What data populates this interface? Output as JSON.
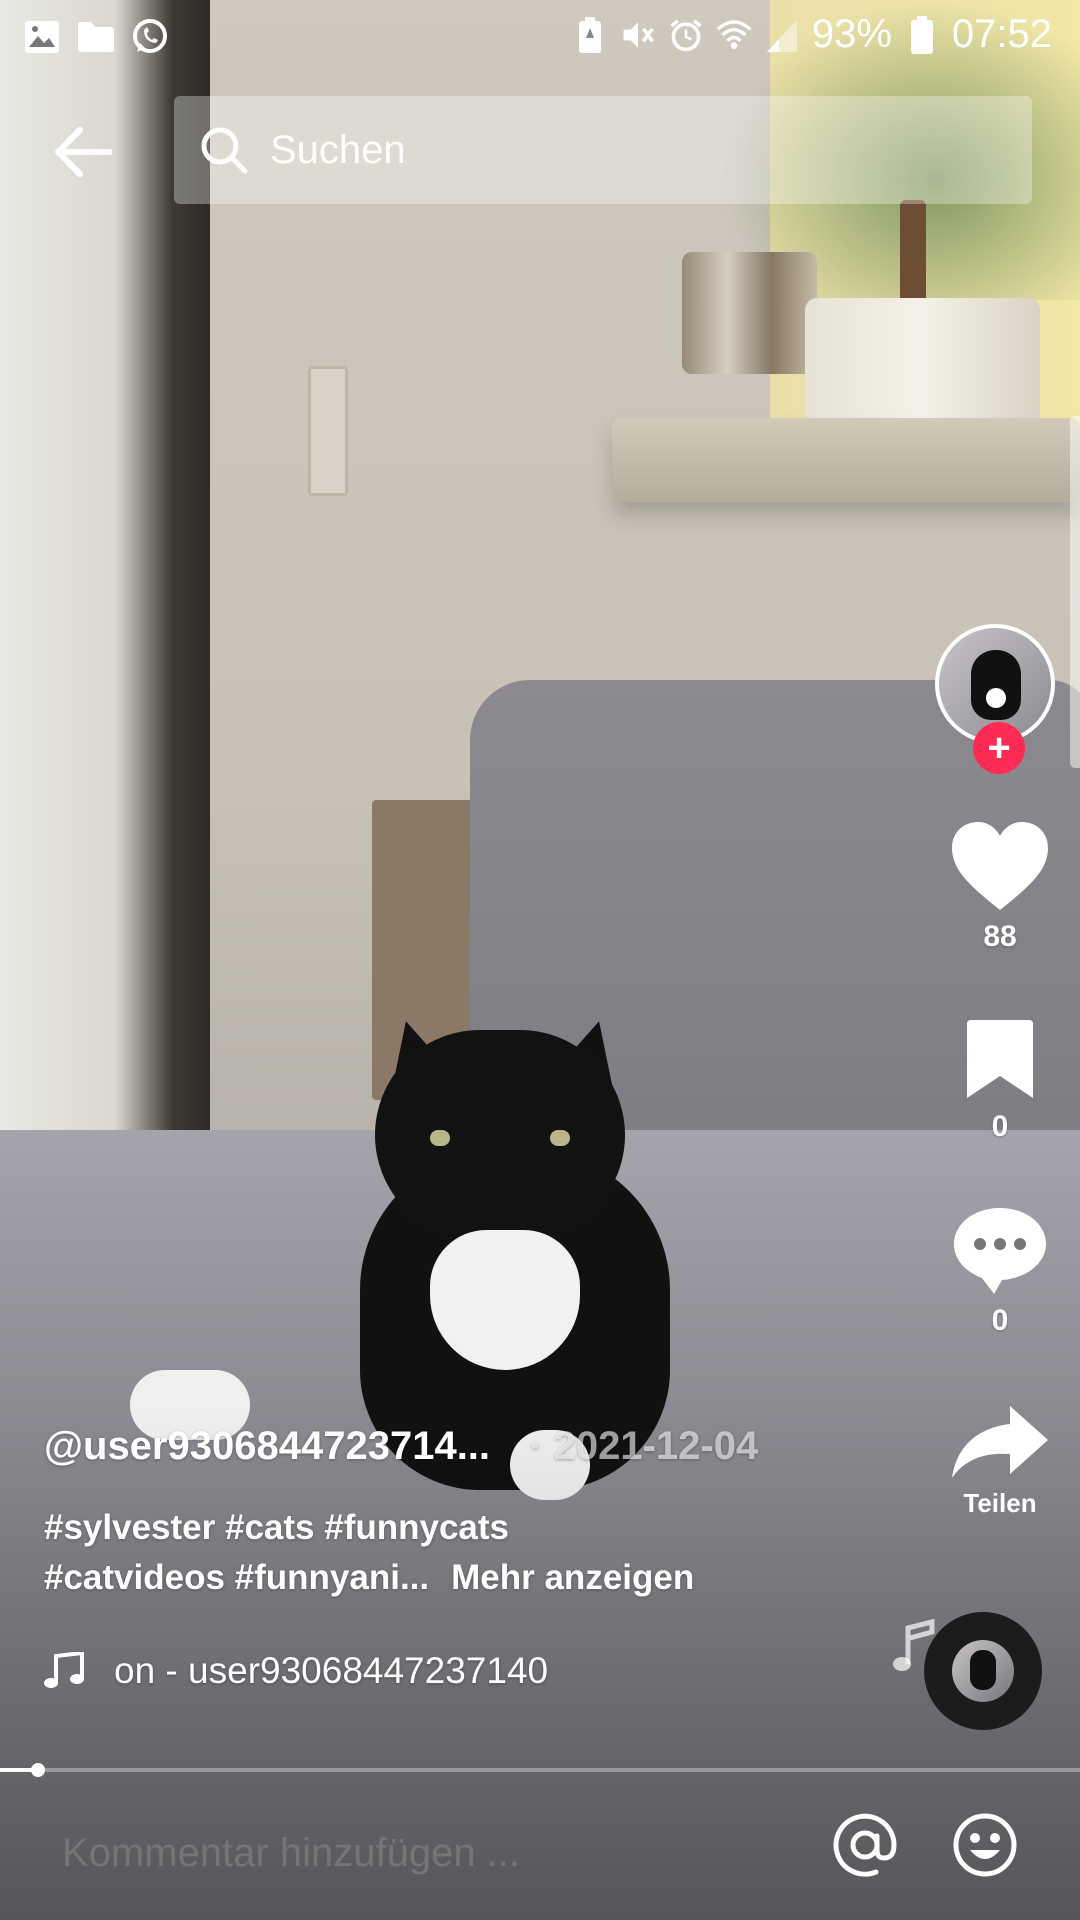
{
  "status_bar": {
    "battery": "93%",
    "time": "07:52",
    "left_icons": [
      "gallery-icon",
      "folder-icon",
      "whatsapp-icon"
    ],
    "right_icons": [
      "battery-saver-icon",
      "mute-icon",
      "alarm-icon",
      "wifi-icon",
      "signal-icon",
      "battery-icon"
    ]
  },
  "top_bar": {
    "search_placeholder": "Suchen"
  },
  "actions": {
    "likes": "88",
    "saves": "0",
    "comments": "0",
    "share_label": "Teilen",
    "follow_symbol": "+"
  },
  "caption": {
    "username": "@user9306844723714...",
    "date": "· 2021-12-04",
    "tags_line1": "#sylvester #cats #funnycats",
    "tags_line2": "#catvideos #funnyani...",
    "more_label": "Mehr anzeigen"
  },
  "music": {
    "text": "on - user93068447237140"
  },
  "progress": {
    "fraction": 0.035
  },
  "comment_bar": {
    "placeholder": "Kommentar hinzufügen ..."
  },
  "colors": {
    "follow_badge": "#fe2c55"
  }
}
